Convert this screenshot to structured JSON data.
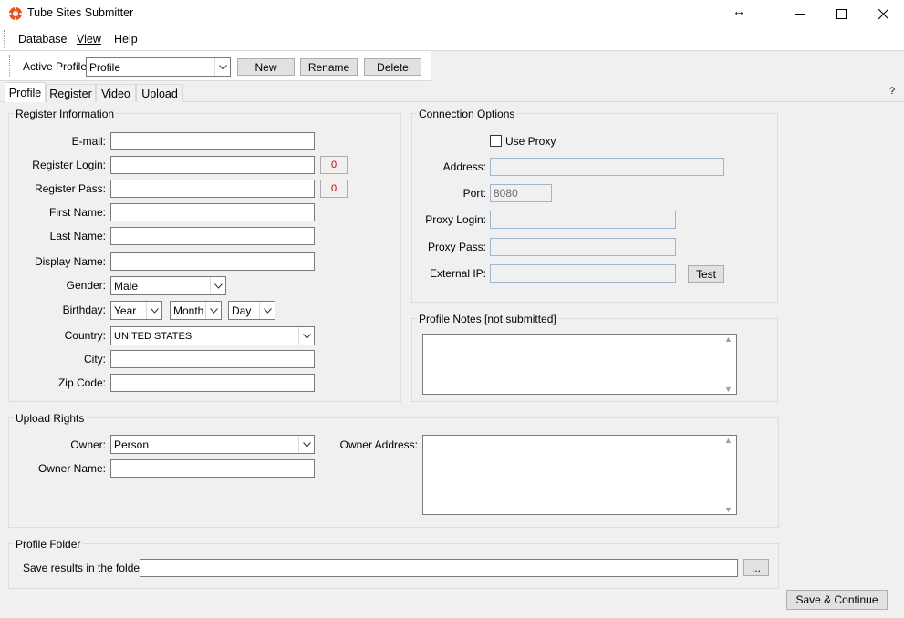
{
  "window": {
    "title": "Tube Sites Submitter"
  },
  "menu": {
    "database": "Database",
    "view": "View",
    "help": "Help"
  },
  "toolbar": {
    "active_profile_label": "Active Profile:",
    "profile_value": "Profile",
    "new": "New",
    "rename": "Rename",
    "delete": "Delete"
  },
  "tabs": {
    "profile": "Profile",
    "register": "Register",
    "video": "Video",
    "upload": "Upload"
  },
  "help_glyph": "?",
  "register_info": {
    "legend": "Register Information",
    "email": "E-mail:",
    "login": "Register Login:",
    "login_count": "0",
    "pass": "Register Pass:",
    "pass_count": "0",
    "first_name": "First Name:",
    "last_name": "Last Name:",
    "display_name": "Display Name:",
    "gender": "Gender:",
    "gender_value": "Male",
    "birthday": "Birthday:",
    "year": "Year",
    "month": "Month",
    "day": "Day",
    "country": "Country:",
    "country_value": "UNITED STATES",
    "city": "City:",
    "zip": "Zip Code:"
  },
  "connection": {
    "legend": "Connection Options",
    "use_proxy": "Use Proxy",
    "address": "Address:",
    "port": "Port:",
    "port_value": "8080",
    "proxy_login": "Proxy Login:",
    "proxy_pass": "Proxy Pass:",
    "external_ip": "External IP:",
    "test": "Test"
  },
  "notes": {
    "legend": "Profile Notes [not submitted]"
  },
  "upload_rights": {
    "legend": "Upload Rights",
    "owner": "Owner:",
    "owner_value": "Person",
    "owner_name": "Owner Name:",
    "owner_address": "Owner Address:"
  },
  "folder": {
    "legend": "Profile Folder",
    "label": "Save results in the folder:",
    "browse": "..."
  },
  "save_continue": "Save & Continue"
}
